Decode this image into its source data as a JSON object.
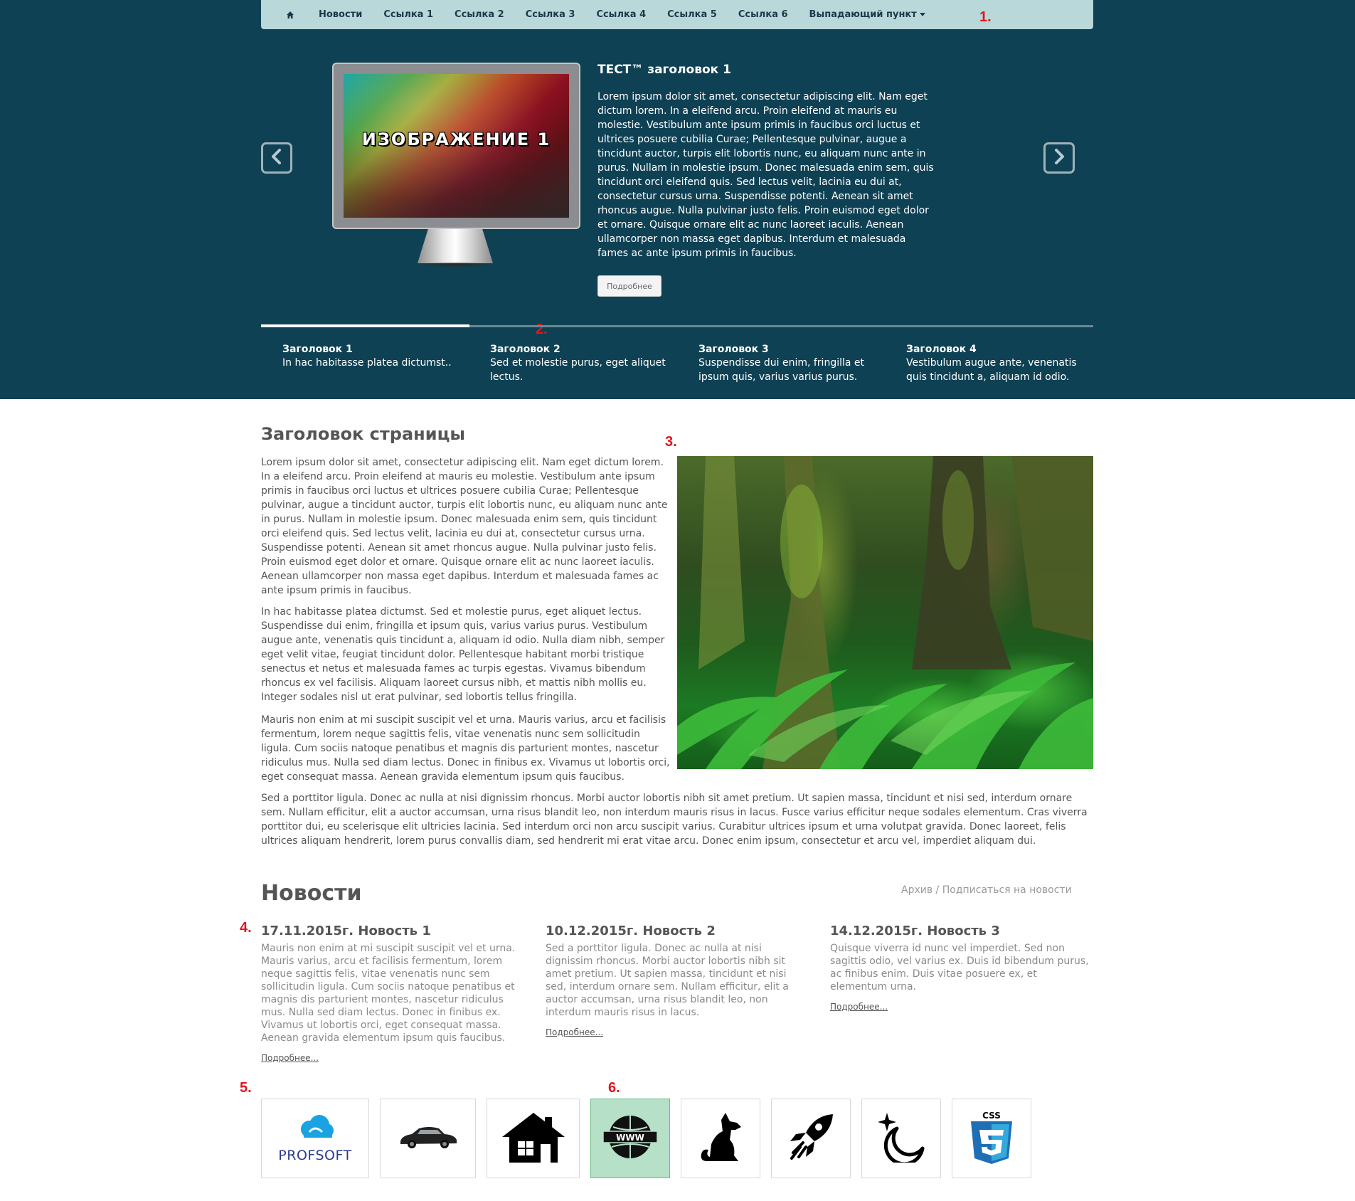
{
  "nav": {
    "items": [
      {
        "label": "Новости"
      },
      {
        "label": "Ссылка 1"
      },
      {
        "label": "Ссылка 2"
      },
      {
        "label": "Ссылка 3"
      },
      {
        "label": "Ссылка 4"
      },
      {
        "label": "Ссылка 5"
      },
      {
        "label": "Ссылка 6"
      }
    ],
    "dropdown_label": "Выпадающий пункт",
    "home_icon": "home-icon"
  },
  "markers": [
    "1.",
    "2.",
    "3.",
    "4.",
    "5.",
    "6."
  ],
  "slider": {
    "image_caption": "ИЗОБРАЖЕНИЕ 1",
    "title": "ТЕСТ™ заголовок 1",
    "text": "Lorem ipsum dolor sit amet, consectetur adipiscing elit. Nam eget dictum lorem. In a eleifend arcu. Proin eleifend at mauris eu molestie. Vestibulum ante ipsum primis in faucibus orci luctus et ultrices posuere cubilia Curae; Pellentesque pulvinar, augue a tincidunt auctor, turpis elit lobortis nunc, eu aliquam nunc ante in purus. Nullam in molestie ipsum. Donec malesuada enim sem, quis tincidunt orci eleifend quis. Sed lectus velit, lacinia eu dui at, consectetur cursus urna. Suspendisse potenti. Aenean sit amet rhoncus augue. Nulla pulvinar justo felis. Proin euismod eget dolor et ornare. Quisque ornare elit ac nunc laoreet iaculis. Aenean ullamcorper non massa eget dapibus. Interdum et malesuada fames ac ante ipsum primis in faucibus.",
    "button_label": "Подробнее",
    "prev_icon": "chevron-left-icon",
    "next_icon": "chevron-right-icon",
    "tabs": [
      {
        "title": "Заголовок 1",
        "desc": "In hac habitasse platea dictumst.."
      },
      {
        "title": "Заголовок 2",
        "desc": "Sed et molestie purus, eget aliquet lectus."
      },
      {
        "title": "Заголовок 3",
        "desc": "Suspendisse dui enim, fringilla et ipsum quis, varius varius purus."
      },
      {
        "title": "Заголовок 4",
        "desc": "Vestibulum augue ante, venenatis quis tincidunt a, aliquam id odio."
      }
    ],
    "active_tab": 0
  },
  "page": {
    "title": "Заголовок страницы",
    "paragraphs": [
      "Lorem ipsum dolor sit amet, consectetur adipiscing elit. Nam eget dictum lorem. In a eleifend arcu. Proin eleifend at mauris eu molestie. Vestibulum ante ipsum primis in faucibus orci luctus et ultrices posuere cubilia Curae; Pellentesque pulvinar, augue a tincidunt auctor, turpis elit lobortis nunc, eu aliquam nunc ante in purus. Nullam in molestie ipsum. Donec malesuada enim sem, quis tincidunt orci eleifend quis. Sed lectus velit, lacinia eu dui at, consectetur cursus urna. Suspendisse potenti. Aenean sit amet rhoncus augue. Nulla pulvinar justo felis. Proin euismod eget dolor et ornare. Quisque ornare elit ac nunc laoreet iaculis. Aenean ullamcorper non massa eget dapibus. Interdum et malesuada fames ac ante ipsum primis in faucibus.",
      "In hac habitasse platea dictumst. Sed et molestie purus, eget aliquet lectus. Suspendisse dui enim, fringilla et ipsum quis, varius varius purus. Vestibulum augue ante, venenatis quis tincidunt a, aliquam id odio. Nulla diam nibh, semper eget velit vitae, feugiat tincidunt dolor. Pellentesque habitant morbi tristique senectus et netus et malesuada fames ac turpis egestas. Vivamus bibendum rhoncus ex vel facilisis. Aliquam laoreet cursus nibh, et mattis nibh mollis eu. Integer sodales nisl ut erat pulvinar, sed lobortis tellus fringilla.",
      "Mauris non enim at mi suscipit suscipit vel et urna. Mauris varius, arcu et facilisis fermentum, lorem neque sagittis felis, vitae venenatis nunc sem sollicitudin ligula. Cum sociis natoque penatibus et magnis dis parturient montes, nascetur ridiculus mus. Nulla sed diam lectus. Donec in finibus ex. Vivamus ut lobortis orci, eget consequat massa. Aenean gravida elementum ipsum quis faucibus.",
      "Sed a porttitor ligula. Donec ac nulla at nisi dignissim rhoncus. Morbi auctor lobortis nibh sit amet pretium. Ut sapien massa, tincidunt et nisi sed, interdum ornare sem. Nullam efficitur, elit a auctor accumsan, urna risus blandit leo, non interdum mauris risus in lacus. Fusce varius efficitur neque sodales elementum. Cras viverra porttitor dui, eu scelerisque elit ultricies lacinia. Sed interdum orci non arcu suscipit varius. Curabitur ultrices ipsum et urna volutpat gravida. Donec laoreet, felis ultrices aliquam hendrerit, lorem purus convallis diam, sed hendrerit mi erat vitae arcu. Donec enim ipsum, consectetur et arcu vel, imperdiet aliquam dui."
    ]
  },
  "news": {
    "heading": "Новости",
    "archive_link": "Архив",
    "separator": " / ",
    "subscribe_link": "Подписаться на новости",
    "items": [
      {
        "title": "17.11.2015г. Новость 1",
        "text": "Mauris non enim at mi suscipit suscipit vel et urna. Mauris varius, arcu et facilisis fermentum, lorem neque sagittis felis, vitae venenatis nunc sem sollicitudin ligula. Cum sociis natoque penatibus et magnis dis parturient montes, nascetur ridiculus mus. Nulla sed diam lectus. Donec in finibus ex. Vivamus ut lobortis orci, eget consequat massa. Aenean gravida elementum ipsum quis faucibus.",
        "more": "Подробнее..."
      },
      {
        "title": "10.12.2015г. Новость 2",
        "text": "Sed a porttitor ligula. Donec ac nulla at nisi dignissim rhoncus. Morbi auctor lobortis nibh sit amet pretium. Ut sapien massa, tincidunt et nisi sed, interdum ornare sem. Nullam efficitur, elit a auctor accumsan, urna risus blandit leo, non interdum mauris risus in lacus.",
        "more": "Подробнее..."
      },
      {
        "title": "14.12.2015г. Новость 3",
        "text": "Quisque viverra id nunc vel imperdiet. Sed non sagittis odio, vel varius ex. Duis id bibendum purus, ac finibus enim. Duis vitae posuere ex, et elementum urna.",
        "more": "Подробнее..."
      }
    ]
  },
  "tiles": [
    {
      "icon": "profsoft-logo-icon",
      "label": "PROFSOFT"
    },
    {
      "icon": "car-icon"
    },
    {
      "icon": "house-icon"
    },
    {
      "icon": "www-globe-icon",
      "active": true
    },
    {
      "icon": "dog-icon"
    },
    {
      "icon": "rocket-icon"
    },
    {
      "icon": "moon-star-icon"
    },
    {
      "icon": "css3-icon",
      "label": "CSS"
    }
  ],
  "colors": {
    "hero_bg": "#0f4154",
    "navbar_bg": "#b9d8d9",
    "marker": "#e2161e",
    "active_tile_bg": "#b6e0c8"
  }
}
